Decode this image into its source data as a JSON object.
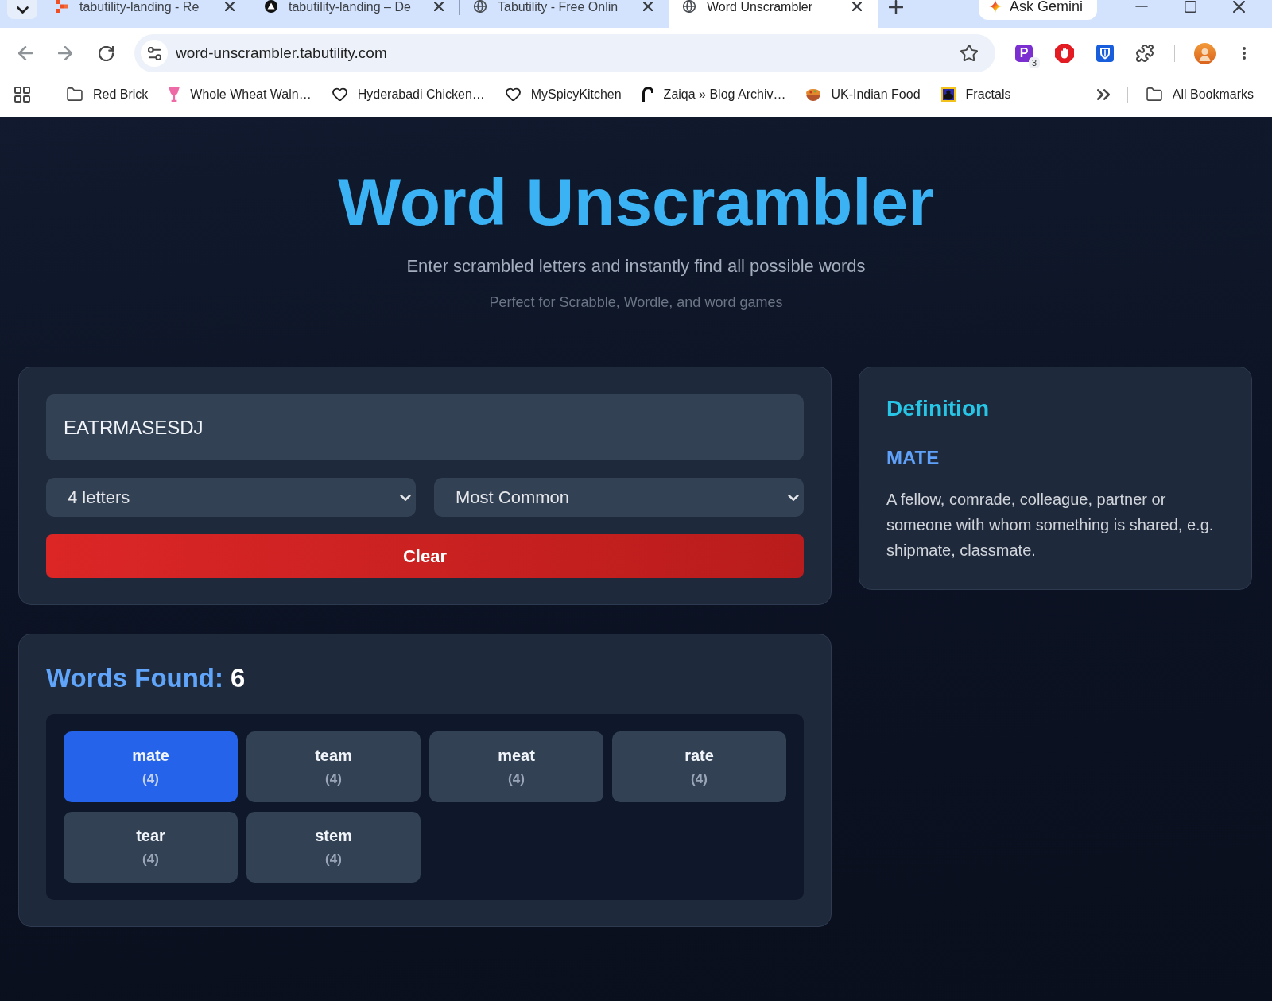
{
  "browser": {
    "tabs": [
      {
        "title": "tabutility-landing - Re",
        "kind": "blocks",
        "selected": false
      },
      {
        "title": "tabutility-landing – De",
        "kind": "triangle",
        "selected": false
      },
      {
        "title": "Tabutility - Free Onlin",
        "kind": "globe",
        "selected": false
      },
      {
        "title": "Word Unscrambler",
        "kind": "globe",
        "selected": true
      }
    ],
    "ask_gemini": "Ask Gemini",
    "address": "word-unscrambler.tabutility.com",
    "extensions": [
      {
        "kind": "letter",
        "label": "P",
        "badge": "3"
      },
      {
        "kind": "stop"
      },
      {
        "kind": "shield"
      },
      {
        "kind": "puzzle"
      }
    ],
    "bookmarks": [
      {
        "label": "Red Brick",
        "kind": "folder"
      },
      {
        "label": "Whole Wheat Waln…",
        "kind": "goblet"
      },
      {
        "label": "Hyderabadi Chicken…",
        "kind": "heart"
      },
      {
        "label": "MySpicyKitchen",
        "kind": "heart"
      },
      {
        "label": "Zaiqa » Blog Archiv…",
        "kind": "hook"
      },
      {
        "label": "UK-Indian Food",
        "kind": "bowl"
      },
      {
        "label": "Fractals",
        "kind": "fractal"
      }
    ],
    "all_bookmarks": "All Bookmarks"
  },
  "header": {
    "title": "Word Unscrambler",
    "subtitle": "Enter scrambled letters and instantly find all possible words",
    "tagline": "Perfect for Scrabble, Wordle, and word games"
  },
  "search": {
    "letters": {
      "value": "EATRMASESDJ"
    },
    "length_filter": {
      "value": "4 letters"
    },
    "sort_order": {
      "value": "Most Common"
    },
    "clear_button": "Clear"
  },
  "definition": {
    "heading": "Definition",
    "word": "MATE",
    "text": "A fellow, comrade, colleague, partner or someone with whom something is shared, e.g. shipmate, classmate."
  },
  "results": {
    "label": "Words Found:",
    "count": "6",
    "words": [
      {
        "word": "mate",
        "letters": "(4)",
        "selected": true
      },
      {
        "word": "team",
        "letters": "(4)",
        "selected": false
      },
      {
        "word": "meat",
        "letters": "(4)",
        "selected": false
      },
      {
        "word": "rate",
        "letters": "(4)",
        "selected": false
      },
      {
        "word": "tear",
        "letters": "(4)",
        "selected": false
      },
      {
        "word": "stem",
        "letters": "(4)",
        "selected": false
      }
    ]
  }
}
